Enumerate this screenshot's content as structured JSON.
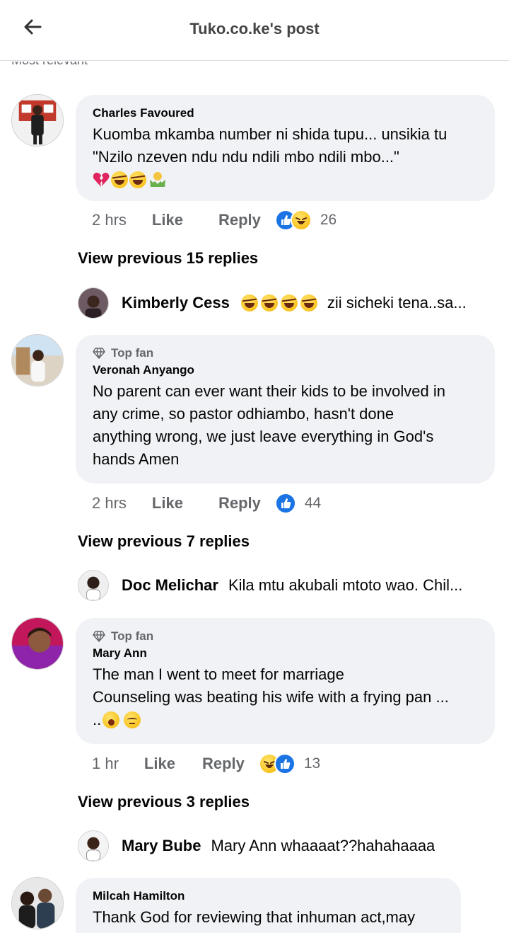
{
  "header": {
    "title": "Tuko.co.ke's post",
    "subtitle": "Most relevant"
  },
  "comments": [
    {
      "author": "Charles Favoured",
      "text": [
        "Kuomba mkamba number ni shida tupu... unsikia tu",
        "\"Nzilo nzeven ndu ndu ndili mbo ndili mbo...\""
      ],
      "emojis": [
        "broken-heart-emoji",
        "rofl-emoji",
        "rofl-emoji",
        "shrug-emoji"
      ],
      "time": "2 hrs",
      "like_label": "Like",
      "reply_label": "Reply",
      "reactions": [
        "like-reaction-icon",
        "haha-reaction-icon"
      ],
      "reaction_count": "26",
      "view_previous": "View previous 15 replies",
      "latest_reply": {
        "name": "Kimberly Cess",
        "emojis": [
          "rofl-emoji",
          "rofl-emoji",
          "rofl-emoji",
          "rofl-emoji"
        ],
        "text": "zii sicheki tena..sa..."
      }
    },
    {
      "badge": "Top fan",
      "author": "Veronah Anyango",
      "text": [
        "No parent can ever want their kids to be involved in",
        "any crime, so pastor odhiambo, hasn't done",
        "anything wrong, we just leave everything in God's",
        "hands Amen"
      ],
      "time": "2 hrs",
      "like_label": "Like",
      "reply_label": "Reply",
      "reactions": [
        "like-reaction-icon"
      ],
      "reaction_count": "44",
      "view_previous": "View previous 7 replies",
      "latest_reply": {
        "name": "Doc Melichar",
        "text": "Kila mtu akubali mtoto wao. Chil..."
      }
    },
    {
      "badge": "Top fan",
      "author": "Mary Ann",
      "text": [
        "The man I went to meet for marriage",
        "Counseling was beating his wife with a frying pan ..."
      ],
      "emoji_prefix": "..",
      "emojis": [
        "yawning-emoji",
        "relieved-emoji"
      ],
      "time": "1 hr",
      "like_label": "Like",
      "reply_label": "Reply",
      "reactions": [
        "haha-reaction-icon",
        "like-reaction-icon"
      ],
      "reaction_count": "13",
      "view_previous": "View previous 3 replies",
      "latest_reply": {
        "name": "Mary Bube",
        "text": "Mary Ann whaaaat??hahahaaaa"
      }
    },
    {
      "author": "Milcah Hamilton",
      "text": [
        "Thank God for reviewing that inhuman act,may"
      ]
    }
  ],
  "colors": {
    "bubble": "#f0f2f5",
    "like_blue": "#1b74e4",
    "muted": "#65676b",
    "text": "#050505"
  }
}
